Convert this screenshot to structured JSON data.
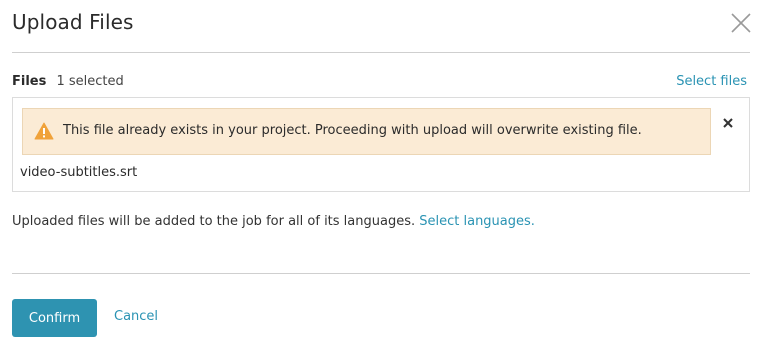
{
  "dialog": {
    "title": "Upload Files",
    "close_icon": "close-icon"
  },
  "files": {
    "label": "Files",
    "selected_count": "1 selected",
    "select_link": "Select files",
    "warning": {
      "icon": "warning-triangle-icon",
      "icon_color": "#f0a23a",
      "text": "This file already exists in your project. Proceeding with upload will overwrite existing file.",
      "background": "#fbebd5"
    },
    "items": [
      {
        "name": "video-subtitles.srt",
        "remove_icon": "remove-x-icon"
      }
    ]
  },
  "info": {
    "text": "Uploaded files will be added to the job for all of its languages.",
    "link": "Select languages."
  },
  "actions": {
    "confirm_label": "Confirm",
    "cancel_label": "Cancel",
    "accent_color": "#2e93b1"
  }
}
